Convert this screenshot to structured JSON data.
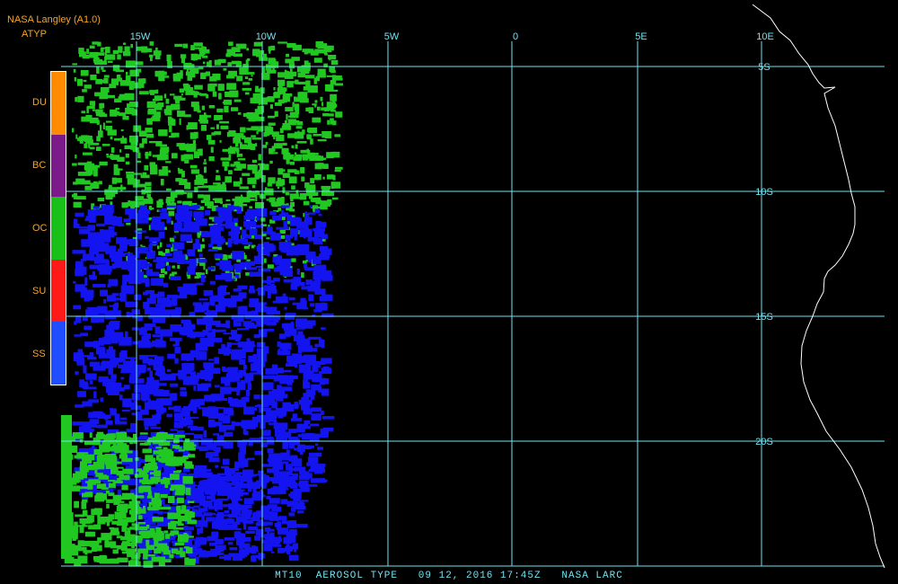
{
  "header": {
    "source": "NASA Langley (A1.0)",
    "product": "ATYP"
  },
  "legend": {
    "items": [
      {
        "label": "DU",
        "color": "#ff8c00"
      },
      {
        "label": "BC",
        "color": "#7b1b8a"
      },
      {
        "label": "OC",
        "color": "#18c018"
      },
      {
        "label": "SU",
        "color": "#ff1a1a"
      },
      {
        "label": "SS",
        "color": "#1f4dff"
      }
    ]
  },
  "grid": {
    "color": "#6fe3f0",
    "longitudes": [
      "15W",
      "10W",
      "5W",
      "0",
      "5E",
      "10E"
    ],
    "latitudes": [
      "5S",
      "10S",
      "15S",
      "20S"
    ]
  },
  "colors": {
    "oc_fill": "#22c822",
    "ss_fill": "#1414f0",
    "coastline": "#ffffff"
  },
  "caption": "MT10  AEROSOL TYPE   09 12, 2016 17:45Z   NASA LARC"
}
